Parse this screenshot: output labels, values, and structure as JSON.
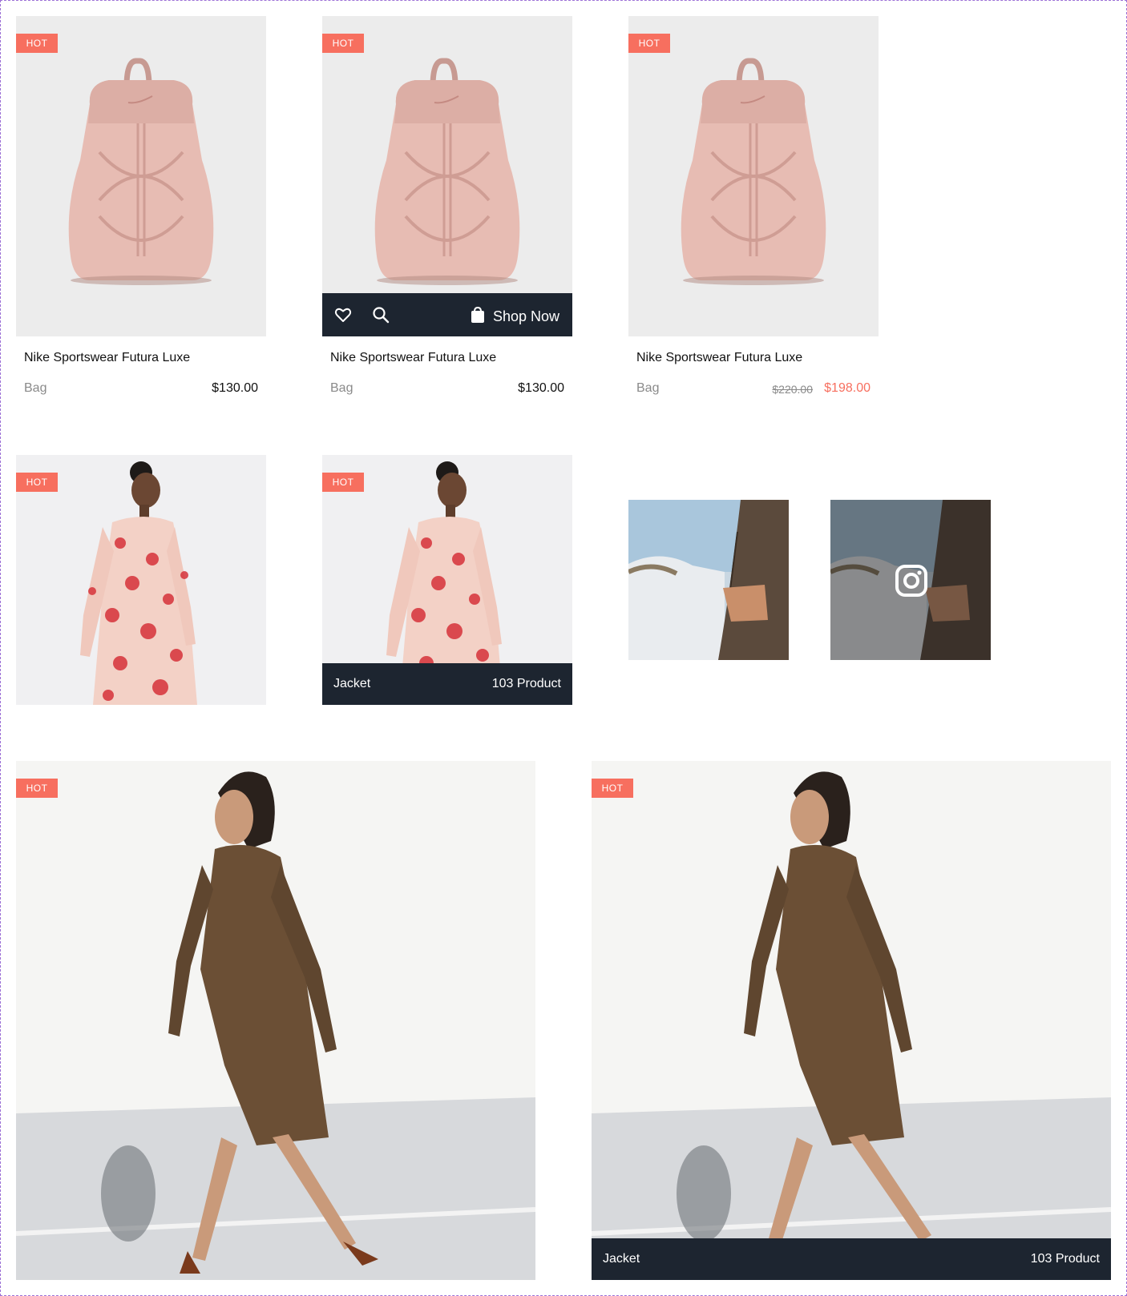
{
  "badge": "HOT",
  "products": [
    {
      "title": "Nike Sportswear Futura Luxe",
      "category": "Bag",
      "price": "$130.00"
    },
    {
      "title": "Nike Sportswear Futura Luxe",
      "category": "Bag",
      "price": "$130.00"
    },
    {
      "title": "Nike Sportswear Futura Luxe",
      "category": "Bag",
      "old_price": "$220.00",
      "price": "$198.00"
    }
  ],
  "hover_actions": {
    "shop_now": "Shop Now",
    "icons": [
      "heart-icon",
      "search-icon",
      "bag-icon"
    ]
  },
  "categories": [
    {
      "name": "Jacket",
      "count": "103 Product"
    },
    {
      "name": "Jacket",
      "count": "103 Product"
    }
  ],
  "instagram_icon": "instagram-icon",
  "colors": {
    "accent": "#f76f5f",
    "dark": "#1d2530",
    "muted": "#8a8a8a"
  }
}
